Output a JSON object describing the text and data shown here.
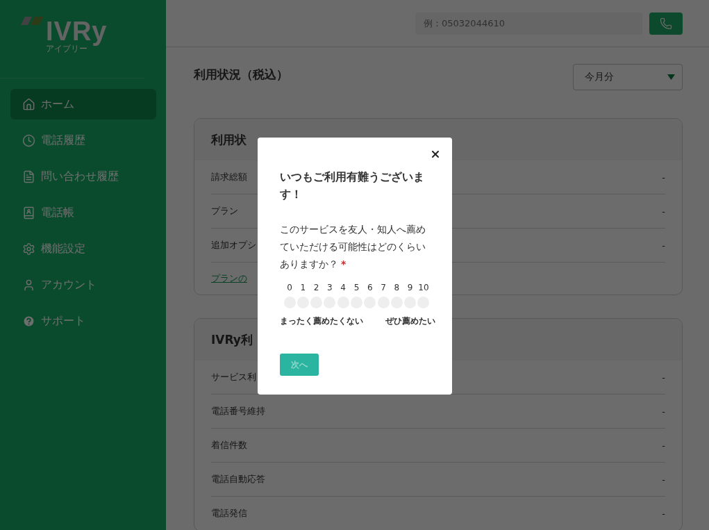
{
  "logo": {
    "name": "IVRy",
    "reading": "アイブリー"
  },
  "sidebar": {
    "items": [
      {
        "label": "ホーム",
        "kind": "home",
        "selected": true
      },
      {
        "label": "電話履歴",
        "kind": "clock",
        "selected": false
      },
      {
        "label": "問い合わせ履歴",
        "kind": "document",
        "selected": false
      },
      {
        "label": "電話帳",
        "kind": "book",
        "selected": false
      },
      {
        "label": "機能設定",
        "kind": "gear",
        "selected": false
      },
      {
        "label": "アカウント",
        "kind": "user",
        "selected": false
      },
      {
        "label": "サポート",
        "kind": "help",
        "selected": false
      }
    ]
  },
  "header": {
    "phone_search": {
      "placeholder": "例：05032044610"
    }
  },
  "page_title": "利用状況（税込）",
  "period_select": {
    "value": "今月分"
  },
  "cards": [
    {
      "title": "利用状",
      "rows": [
        {
          "label": "請求総額",
          "value": "-"
        },
        {
          "label": "プラン",
          "value": "-"
        },
        {
          "label": "追加オプシ",
          "value": "-"
        }
      ],
      "link": "プランの"
    },
    {
      "title": "IVRy利",
      "rows": [
        {
          "label": "サービス利",
          "value": "-"
        },
        {
          "label": "電話番号維持",
          "value": "-"
        },
        {
          "label": "着信件数",
          "value": "-"
        },
        {
          "label": "電話自動応答",
          "value": "-"
        },
        {
          "label": "電話発信",
          "value": "-"
        }
      ]
    }
  ],
  "modal": {
    "title": "いつもご利用有難うございます！",
    "question": "このサービスを友人・知人へ薦めていただける可能性はどのくらいありますか？",
    "required_mark": "*",
    "scale": [
      {
        "label": "0",
        "selected": false
      },
      {
        "label": "1",
        "selected": false
      },
      {
        "label": "2",
        "selected": false
      },
      {
        "label": "3",
        "selected": false
      },
      {
        "label": "4",
        "selected": false
      },
      {
        "label": "5",
        "selected": false
      },
      {
        "label": "6",
        "selected": false
      },
      {
        "label": "7",
        "selected": false
      },
      {
        "label": "8",
        "selected": false
      },
      {
        "label": "9",
        "selected": false
      },
      {
        "label": "10",
        "selected": false
      }
    ],
    "low_label": "まったく薦めたくない",
    "high_label": "ぜひ薦めたい",
    "next_button": {
      "label": "次へ",
      "disabled": true
    }
  }
}
